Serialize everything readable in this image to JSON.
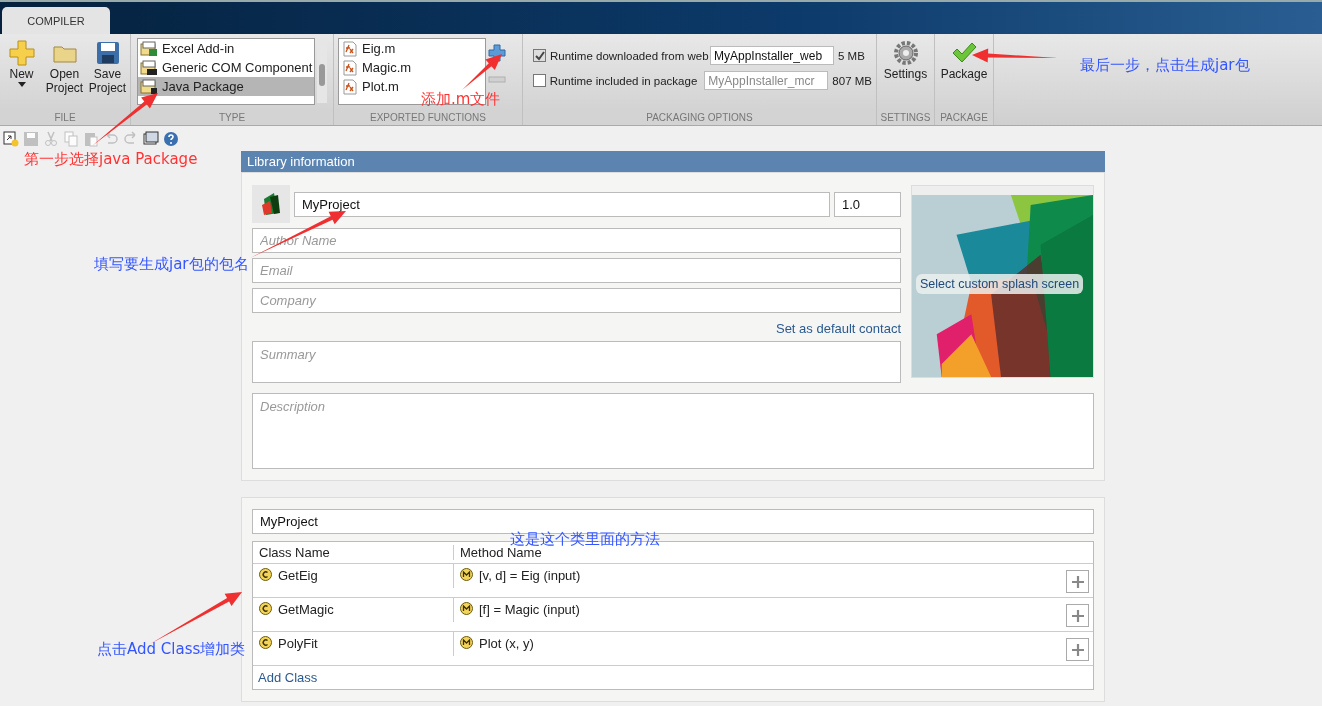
{
  "window": {
    "tab": "COMPILER"
  },
  "toolstrip": {
    "file": {
      "label": "FILE",
      "buttons": [
        {
          "kind": "new",
          "label": "New"
        },
        {
          "kind": "open",
          "label": "Open Project"
        },
        {
          "kind": "save",
          "label": "Save Project"
        }
      ]
    },
    "type": {
      "label": "TYPE",
      "items": [
        {
          "kind": "excel",
          "label": "Excel Add-in",
          "selected": false
        },
        {
          "kind": "com",
          "label": "Generic COM Component",
          "selected": false
        },
        {
          "kind": "java",
          "label": "Java Package",
          "selected": true
        }
      ]
    },
    "exported_functions": {
      "label": "EXPORTED FUNCTIONS",
      "files": [
        "Eig.m",
        "Magic.m",
        "Plot.m"
      ]
    },
    "packaging_options": {
      "label": "PACKAGING OPTIONS",
      "rows": [
        {
          "label": "Runtime downloaded from web",
          "checked": true,
          "value": "MyAppInstaller_web",
          "disabled": false,
          "size": "5 MB"
        },
        {
          "label": "Runtime included in package",
          "checked": false,
          "value": "MyAppInstaller_mcr",
          "disabled": true,
          "size": "807 MB"
        }
      ]
    },
    "settings": {
      "label": "SETTINGS",
      "button": "Settings"
    },
    "package": {
      "label": "PACKAGE",
      "button": "Package"
    }
  },
  "quick_toolbar": [
    {
      "kind": "new",
      "disabled": false
    },
    {
      "kind": "save",
      "disabled": true
    },
    {
      "kind": "cut",
      "disabled": true
    },
    {
      "kind": "copy",
      "disabled": true
    },
    {
      "kind": "paste",
      "disabled": true
    },
    {
      "kind": "undo",
      "disabled": true
    },
    {
      "kind": "redo",
      "disabled": true
    },
    {
      "kind": "window",
      "disabled": false
    },
    {
      "kind": "help",
      "disabled": false
    }
  ],
  "library": {
    "header": "Library information",
    "name": "MyProject",
    "version": "1.0",
    "author_placeholder": "Author Name",
    "email_placeholder": "Email",
    "company_placeholder": "Company",
    "default_contact_link": "Set as default contact",
    "summary_placeholder": "Summary",
    "description_placeholder": "Description",
    "splash_button": "Select custom splash screen"
  },
  "classes": {
    "package_name": "MyProject",
    "columns": [
      "Class Name",
      "Method Name"
    ],
    "rows": [
      {
        "class_name": "GetEig",
        "method": "[v, d] = Eig (input)"
      },
      {
        "class_name": "GetMagic",
        "method": "[f] = Magic (input)"
      },
      {
        "class_name": "PolyFit",
        "method": "Plot (x, y)"
      }
    ],
    "add_class": "Add Class"
  },
  "annotations": [
    {
      "text": "第一步选择java Package",
      "color": "#ff3333"
    },
    {
      "text": "添加.m文件",
      "color": "#ff3333"
    },
    {
      "text": "最后一步，点击生成jar包",
      "color": "#3355ff"
    },
    {
      "text": "填写要生成jar包的包名",
      "color": "#3355ff"
    },
    {
      "text": "这是这个类里面的方法",
      "color": "#3355ff"
    },
    {
      "text": "点击Add Class增加类",
      "color": "#3355ff"
    }
  ]
}
